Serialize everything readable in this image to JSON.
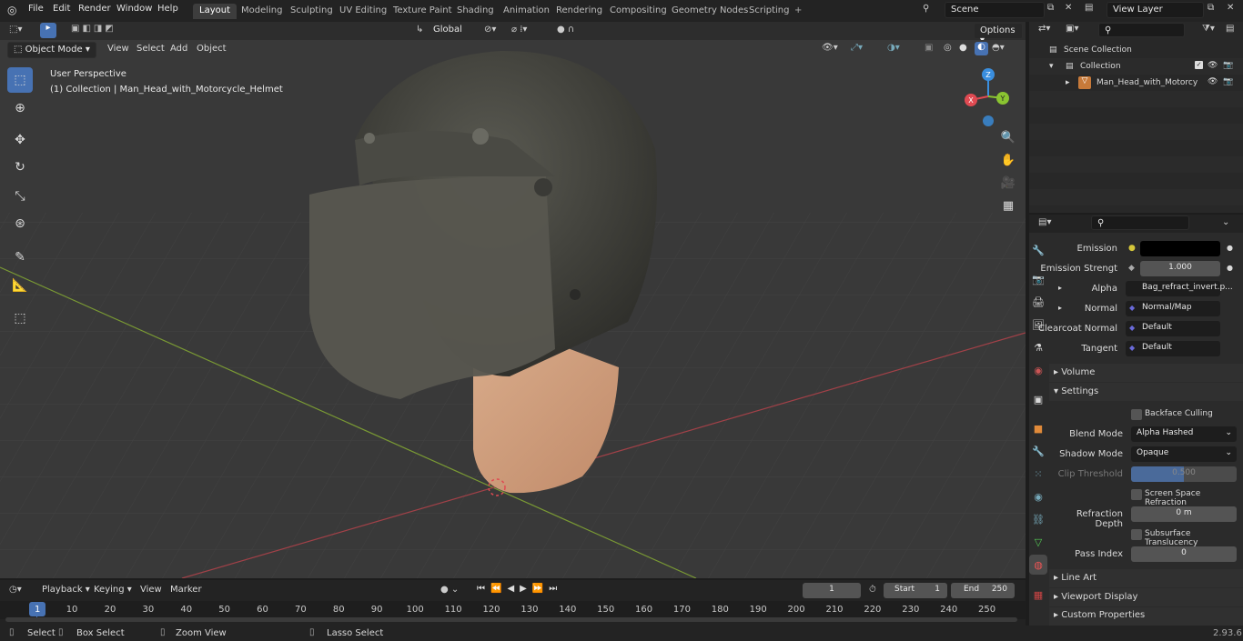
{
  "topbar": {
    "menus": [
      "File",
      "Edit",
      "Render",
      "Window",
      "Help"
    ],
    "workspaces": [
      "Layout",
      "Modeling",
      "Sculpting",
      "UV Editing",
      "Texture Paint",
      "Shading",
      "Animation",
      "Rendering",
      "Compositing",
      "Geometry Nodes",
      "Scripting"
    ],
    "active_workspace": "Layout",
    "add_tab": "+",
    "scene": "Scene",
    "view_layer": "View Layer"
  },
  "viewport_header": {
    "mode": "Object Mode",
    "menus": [
      "View",
      "Select",
      "Add",
      "Object"
    ],
    "transform_orientation": "Global",
    "options": "Options"
  },
  "viewport": {
    "perspective": "User Perspective",
    "collection_info": "(1) Collection | Man_Head_with_Motorcycle_Helmet",
    "gizmo": {
      "x": "X",
      "y": "Y",
      "z": "Z"
    }
  },
  "outliner": {
    "scene_collection": "Scene Collection",
    "collection": "Collection",
    "object": "Man_Head_with_Motorcy"
  },
  "properties": {
    "emission_label": "Emission",
    "emission_strength_label": "Emission Strengt",
    "emission_strength_value": "1.000",
    "alpha_label": "Alpha",
    "alpha_value": "Bag_refract_invert.p...",
    "normal_label": "Normal",
    "normal_value": "Normal/Map",
    "clearcoat_label": "Clearcoat Normal",
    "clearcoat_value": "Default",
    "tangent_label": "Tangent",
    "tangent_value": "Default",
    "volume": "Volume",
    "settings": "Settings",
    "backface_culling": "Backface Culling",
    "blend_mode_label": "Blend Mode",
    "blend_mode_value": "Alpha Hashed",
    "shadow_mode_label": "Shadow Mode",
    "shadow_mode_value": "Opaque",
    "clip_threshold_label": "Clip Threshold",
    "clip_threshold_value": "0.500",
    "screen_space_refraction": "Screen Space Refraction",
    "refraction_depth_label": "Refraction Depth",
    "refraction_depth_value": "0 m",
    "subsurface_translucency": "Subsurface Translucency",
    "pass_index_label": "Pass Index",
    "pass_index_value": "0",
    "line_art": "Line Art",
    "viewport_display": "Viewport Display",
    "custom_properties": "Custom Properties"
  },
  "timeline": {
    "menus": [
      "Playback",
      "Keying",
      "View",
      "Marker"
    ],
    "current_frame": "1",
    "start_label": "Start",
    "start_value": "1",
    "end_label": "End",
    "end_value": "250",
    "ticks": [
      "1",
      "10",
      "20",
      "30",
      "40",
      "50",
      "60",
      "70",
      "80",
      "90",
      "100",
      "110",
      "120",
      "130",
      "140",
      "150",
      "160",
      "170",
      "180",
      "190",
      "200",
      "210",
      "220",
      "230",
      "240",
      "250"
    ]
  },
  "status_bar": {
    "select": "Select",
    "box_select": "Box Select",
    "zoom_view": "Zoom View",
    "lasso_select": "Lasso Select",
    "version": "2.93.6"
  },
  "colors": {
    "accent": "#4772b3",
    "x_axis": "#e04a52",
    "y_axis": "#8ac431",
    "z_axis": "#3a8ede"
  }
}
